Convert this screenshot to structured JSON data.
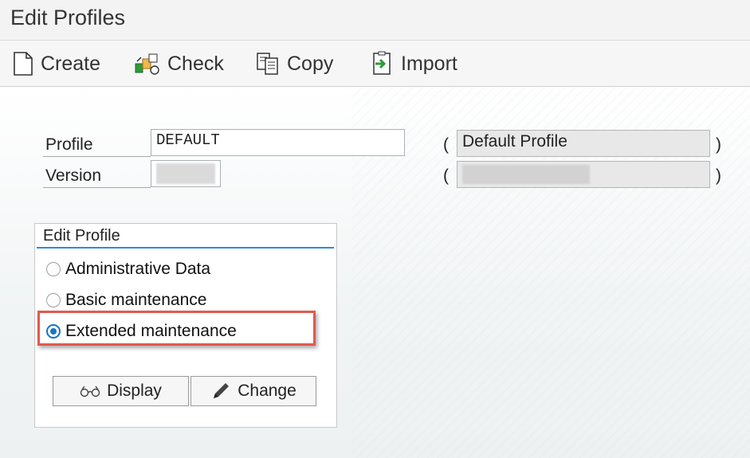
{
  "window": {
    "title": "Edit Profiles"
  },
  "toolbar": {
    "create_label": "Create",
    "check_label": "Check",
    "copy_label": "Copy",
    "import_label": "Import"
  },
  "form": {
    "profile_label": "Profile",
    "profile_value": "DEFAULT",
    "profile_description": "Default Profile",
    "version_label": "Version",
    "open_paren": "(",
    "close_paren": ")"
  },
  "edit_profile": {
    "title": "Edit Profile",
    "options": [
      {
        "label": "Administrative Data",
        "selected": false
      },
      {
        "label": "Basic maintenance",
        "selected": false
      },
      {
        "label": "Extended maintenance",
        "selected": true
      }
    ],
    "display_label": "Display",
    "change_label": "Change"
  },
  "colors": {
    "accent": "#2b8dd8",
    "radio_selected": "#1a73c7",
    "highlight": "#e3584f"
  }
}
